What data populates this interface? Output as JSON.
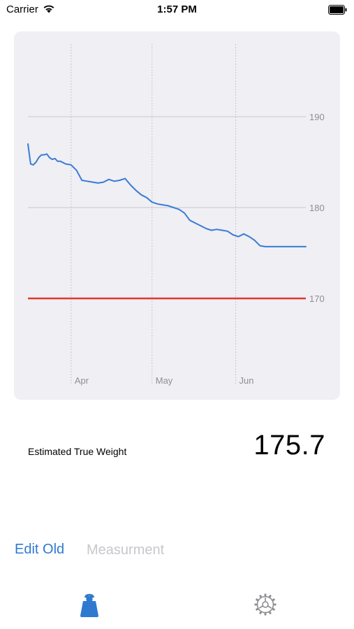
{
  "status_bar": {
    "carrier": "Carrier",
    "time": "1:57 PM"
  },
  "chart_data": {
    "type": "line",
    "x": [
      "Mar 16",
      "Mar 17",
      "Mar 18",
      "Mar 19",
      "Mar 20",
      "Mar 21",
      "Mar 22",
      "Mar 23",
      "Mar 24",
      "Mar 25",
      "Mar 26",
      "Mar 27",
      "Mar 28",
      "Mar 30",
      "Apr 1",
      "Apr 3",
      "Apr 5",
      "Apr 7",
      "Apr 9",
      "Apr 11",
      "Apr 13",
      "Apr 15",
      "Apr 17",
      "Apr 19",
      "Apr 21",
      "Apr 23",
      "Apr 25",
      "Apr 27",
      "Apr 29",
      "May 1",
      "May 3",
      "May 5",
      "May 7",
      "May 9",
      "May 11",
      "May 13",
      "May 15",
      "May 17",
      "May 19",
      "May 21",
      "May 23",
      "May 25",
      "May 27",
      "May 29",
      "May 31",
      "Jun 2",
      "Jun 4",
      "Jun 6",
      "Jun 8",
      "Jun 10",
      "Jun 12",
      "Jun 14",
      "Jun 16",
      "Jun 18",
      "Jun 20",
      "Jun 22",
      "Jun 24",
      "Jun 26",
      "Jun 27"
    ],
    "series": [
      {
        "values": [
          187.0,
          184.8,
          184.7,
          185.0,
          185.5,
          185.8,
          185.8,
          185.9,
          185.5,
          185.3,
          185.4,
          185.1,
          185.1,
          184.8,
          184.7,
          184.1,
          183.0,
          182.9,
          182.8,
          182.7,
          182.8,
          183.1,
          182.9,
          183.0,
          183.2,
          182.5,
          181.9,
          181.4,
          181.1,
          180.6,
          180.4,
          180.3,
          180.2,
          180.0,
          179.8,
          179.4,
          178.6,
          178.3,
          178.0,
          177.7,
          177.5,
          177.6,
          177.5,
          177.4,
          177.0,
          176.8,
          177.1,
          176.8,
          176.4,
          175.8,
          175.7,
          175.7,
          175.7,
          175.7,
          175.7,
          175.7,
          175.7,
          175.7,
          175.7
        ],
        "color": "#3a7bd5"
      }
    ],
    "reference_line": {
      "value": 170,
      "color": "#e0382e"
    },
    "y_ticks": [
      170,
      180,
      190
    ],
    "x_ticks": [
      "Apr",
      "May",
      "Jun"
    ],
    "ylim": [
      162,
      198
    ],
    "xlim": [
      "Mar 16",
      "Jun 27"
    ],
    "grid": true,
    "title": "",
    "xlabel": "",
    "ylabel": ""
  },
  "summary": {
    "label": "Estimated True Weight",
    "value": "175.7"
  },
  "entry": {
    "edit_label": "Edit Old",
    "placeholder": "Measurment"
  },
  "tab_bar": {
    "items": [
      {
        "icon": "weight-icon",
        "active": true
      },
      {
        "icon": "gear-icon",
        "active": false
      }
    ]
  },
  "colors": {
    "accent": "#2f7ad0",
    "chart_background": "#efeff4",
    "grid": "#c8c8cc",
    "axis_label": "#8e8e93"
  }
}
